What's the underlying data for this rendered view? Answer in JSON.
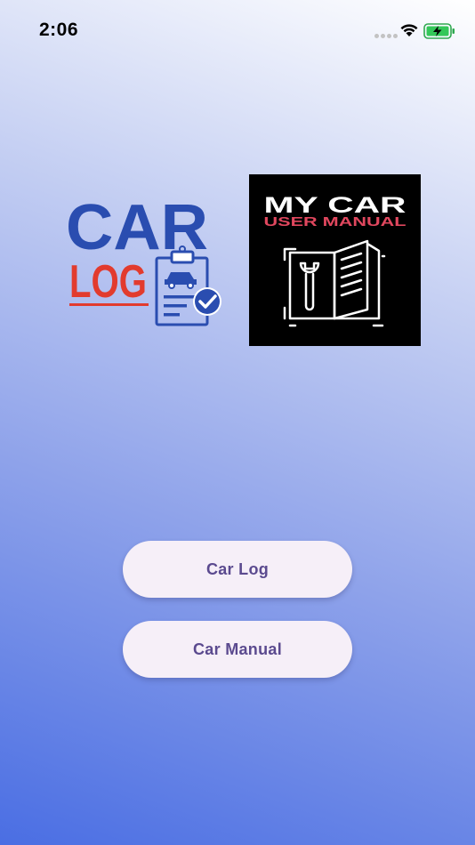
{
  "status_bar": {
    "time": "2:06",
    "icons": [
      "signal-dots-icon",
      "wifi-icon",
      "battery-charging-icon"
    ]
  },
  "logos": {
    "car_log": {
      "line1": "CAR",
      "line2": "LOG",
      "icon": "clipboard-car-check-icon"
    },
    "car_manual": {
      "line1": "MY CAR",
      "line2": "USER MANUAL",
      "icon": "open-manual-wrench-icon"
    }
  },
  "buttons": {
    "car_log": "Car Log",
    "car_manual": "Car Manual"
  },
  "colors": {
    "brand_blue": "#2a4db0",
    "brand_red": "#e23b2e",
    "manual_red": "#e0475e",
    "button_text": "#5b4a8f",
    "button_bg": "#f6eff8"
  }
}
